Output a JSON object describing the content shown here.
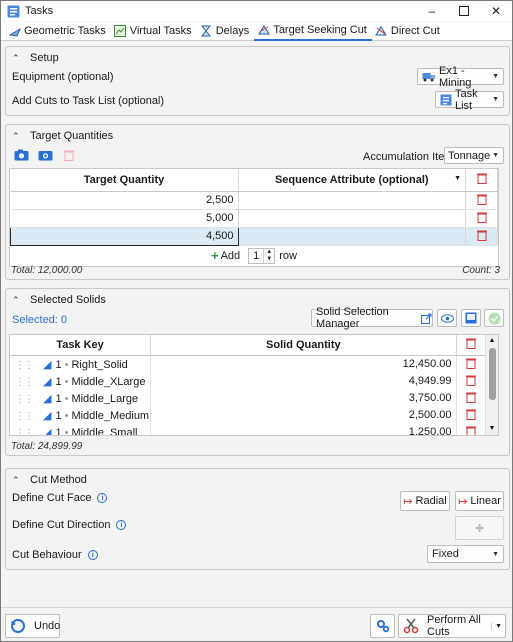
{
  "window": {
    "title": "Tasks"
  },
  "tabs": [
    {
      "label": "Geometric Tasks",
      "icon": "geometric-tasks-icon"
    },
    {
      "label": "Virtual Tasks",
      "icon": "virtual-tasks-icon"
    },
    {
      "label": "Delays",
      "icon": "hourglass-icon"
    },
    {
      "label": "Target Seeking Cut",
      "icon": "target-cut-icon"
    },
    {
      "label": "Direct Cut",
      "icon": "direct-cut-icon"
    }
  ],
  "setup": {
    "title": "Setup",
    "equipment_label": "Equipment (optional)",
    "equipment_value": "Ex1 - Mining",
    "add_cuts_label": "Add Cuts to Task List (optional)",
    "add_cuts_value": "Task List"
  },
  "target_quantities": {
    "title": "Target Quantities",
    "accumulation_label": "Accumulation Item",
    "accumulation_value": "Tonnage",
    "columns": [
      "Target Quantity",
      "Sequence Attribute (optional)"
    ],
    "rows": [
      {
        "target": "2,500",
        "attribute": ""
      },
      {
        "target": "5,000",
        "attribute": ""
      },
      {
        "target": "4,500",
        "attribute": ""
      }
    ],
    "add_label": "Add",
    "add_count": "1",
    "add_suffix": "row",
    "total": "Total: 12,000.00",
    "count": "Count: 3"
  },
  "selected_solids": {
    "title": "Selected Solids",
    "selected": "Selected: 0",
    "manager_button": "Solid Selection Manager",
    "columns": [
      "Task Key",
      "Solid Quantity"
    ],
    "rows": [
      {
        "num": "1",
        "name": "Right_Solid",
        "qty": "12,450.00"
      },
      {
        "num": "1",
        "name": "Middle_XLarge",
        "qty": "4,949.99"
      },
      {
        "num": "1",
        "name": "Middle_Large",
        "qty": "3,750.00"
      },
      {
        "num": "1",
        "name": "Middle_Medium",
        "qty": "2,500.00"
      },
      {
        "num": "1",
        "name": "Middle_Small",
        "qty": "1,250.00"
      }
    ],
    "total": "Total: 24,899.99"
  },
  "cut_method": {
    "title": "Cut Method",
    "face_label": "Define Cut Face",
    "radial_label": "Radial",
    "linear_label": "Linear",
    "direction_label": "Define Cut Direction",
    "behaviour_label": "Cut Behaviour",
    "behaviour_value": "Fixed"
  },
  "bottom": {
    "undo_label": "Undo",
    "perform_label": "Perform All Cuts"
  },
  "colors": {
    "accent": "#2a6fd6",
    "delete": "#d13838",
    "selected_row": "#dbeaf5"
  }
}
